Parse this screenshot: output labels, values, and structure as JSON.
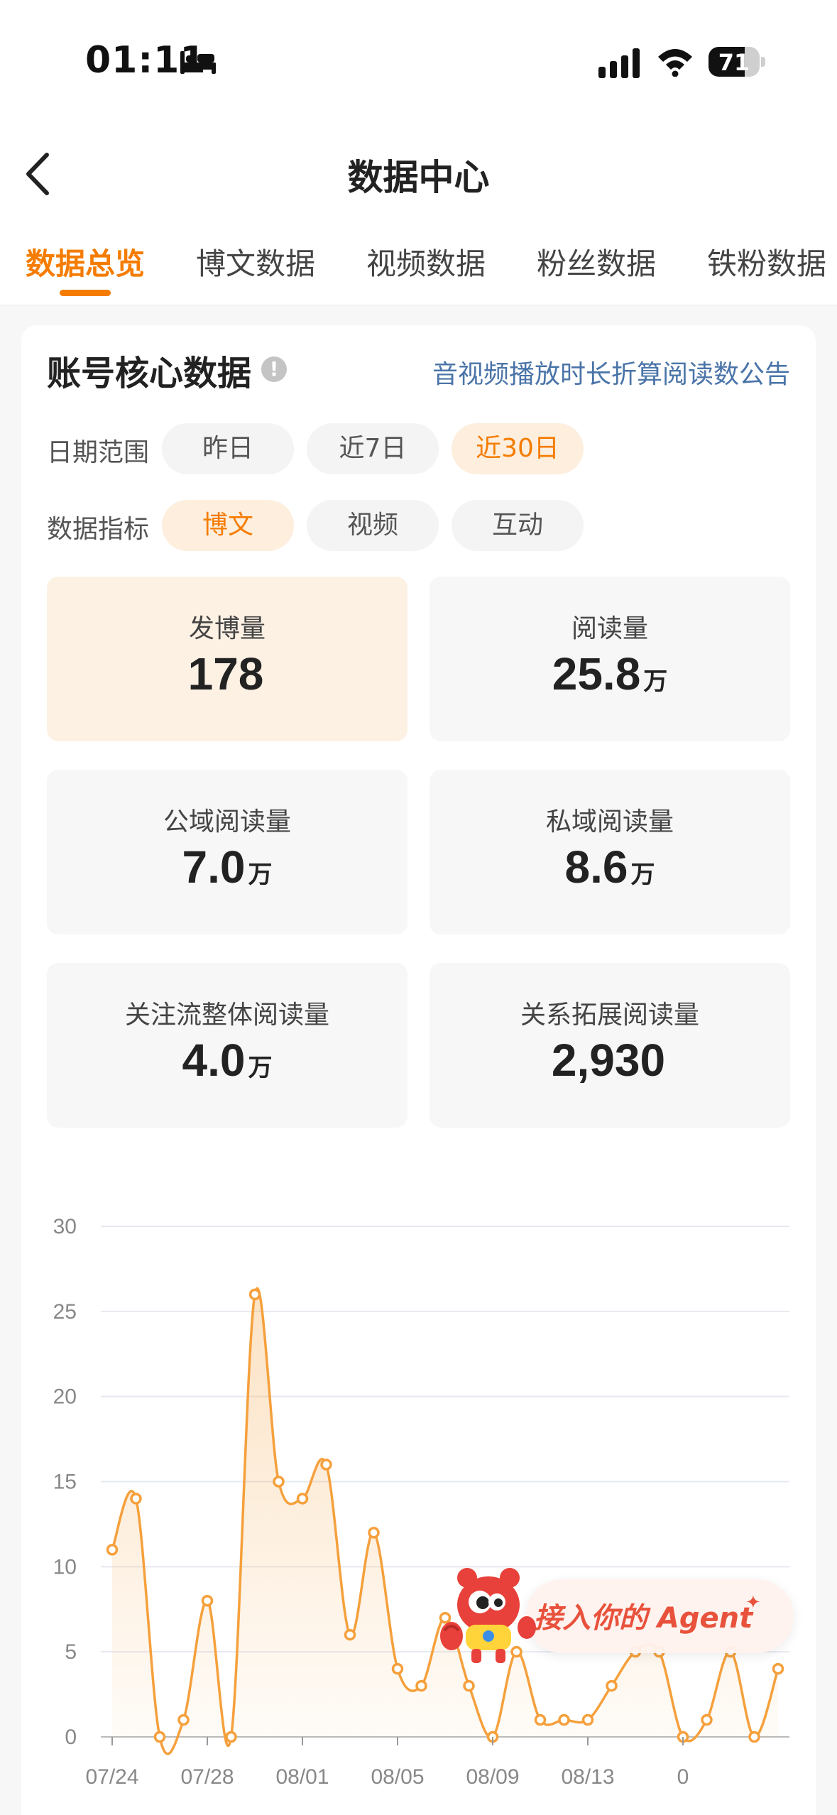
{
  "status_bar": {
    "time": "01:11",
    "battery": "71",
    "battery_level": 0.71
  },
  "header": {
    "title": "数据中心"
  },
  "tabs": [
    {
      "label": "数据总览",
      "active": true
    },
    {
      "label": "博文数据",
      "active": false
    },
    {
      "label": "视频数据",
      "active": false
    },
    {
      "label": "粉丝数据",
      "active": false
    },
    {
      "label": "铁粉数据",
      "active": false
    }
  ],
  "section": {
    "title": "账号核心数据",
    "notice_link": "音视频播放时长折算阅读数公告"
  },
  "date_range": {
    "label": "日期范围",
    "options": [
      "昨日",
      "近7日",
      "近30日"
    ],
    "selected": "近30日"
  },
  "metric": {
    "label": "数据指标",
    "options": [
      "博文",
      "视频",
      "互动"
    ],
    "selected": "博文"
  },
  "stats": [
    {
      "label": "发博量",
      "value": "178",
      "unit": ""
    },
    {
      "label": "阅读量",
      "value": "25.8",
      "unit": "万"
    },
    {
      "label": "公域阅读量",
      "value": "7.0",
      "unit": "万"
    },
    {
      "label": "私域阅读量",
      "value": "8.6",
      "unit": "万"
    },
    {
      "label": "关注流整体阅读量",
      "value": "4.0",
      "unit": "万"
    },
    {
      "label": "关系拓展阅读量",
      "value": "2,930",
      "unit": ""
    }
  ],
  "chart_data": {
    "type": "area",
    "ylim": [
      0,
      30
    ],
    "yticks": [
      0,
      5,
      10,
      15,
      20,
      25,
      30
    ],
    "x_tick_labels": [
      "07/24",
      "07/28",
      "08/01",
      "08/05",
      "08/09",
      "08/13",
      "0"
    ],
    "x_tick_positions": [
      0,
      4,
      8,
      12,
      16,
      20,
      24
    ],
    "series": [
      {
        "values": [
          11,
          14,
          0,
          1,
          8,
          0,
          26,
          15,
          14,
          16,
          6,
          12,
          4,
          3,
          7,
          3,
          0,
          5,
          1,
          1,
          1,
          3,
          5,
          5,
          0,
          1,
          5,
          0,
          4
        ]
      }
    ],
    "line_color": "#f5a03c",
    "grid": true
  },
  "agent_banner": {
    "text": "接入你的 Agent"
  },
  "colors": {
    "accent": "#f57c00",
    "link": "#4a74a8",
    "line": "#f5a03c"
  }
}
